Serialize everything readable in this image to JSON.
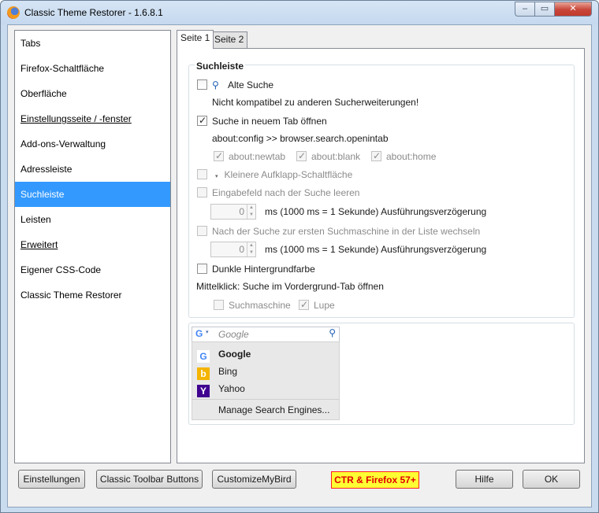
{
  "window": {
    "title": "Classic Theme Restorer - 1.6.8.1",
    "controls": {
      "minimize": "–",
      "maximize": "▭",
      "close": "✕"
    }
  },
  "sidebar": {
    "items": [
      {
        "label": "Tabs"
      },
      {
        "label": "Firefox-Schaltfläche"
      },
      {
        "label": "Oberfläche"
      },
      {
        "label": "Einstellungsseite / -fenster"
      },
      {
        "label": "Add-ons-Verwaltung"
      },
      {
        "label": "Adressleiste"
      },
      {
        "label": "Suchleiste"
      },
      {
        "label": "Leisten"
      },
      {
        "label": "Erweitert"
      },
      {
        "label": "Eigener CSS-Code"
      },
      {
        "label": "Classic Theme Restorer"
      }
    ],
    "selected": "Suchleiste"
  },
  "tabs": [
    "Seite 1",
    "Seite 2"
  ],
  "group": {
    "title": "Suchleiste",
    "alte_suche": "Alte Suche",
    "incompat": "Nicht kompatibel zu anderen Sucherweiterungen!",
    "new_tab": "Suche in neuem Tab öffnen",
    "about_config": "about:config >> browser.search.openintab",
    "sub": {
      "newtab": "about:newtab",
      "blank": "about:blank",
      "home": "about:home"
    },
    "smaller_dropdown": "Kleinere Aufklapp-Schaltfläche",
    "clear_field": "Eingabefeld nach der Suche leeren",
    "delay_1_value": "0",
    "delay_label": "ms (1000 ms = 1 Sekunde) Ausführungsverzögerung",
    "switch_first": "Nach der Suche zur ersten Suchmaschine in der Liste wechseln",
    "delay_2_value": "0",
    "dark_bg": "Dunkle Hintergrundfarbe",
    "middle_click": "Mittelklick: Suche im Vordergrund-Tab öffnen",
    "suchmaschine": "Suchmaschine",
    "lupe": "Lupe"
  },
  "preview": {
    "placeholder": "Google",
    "engines": [
      {
        "name": "Google",
        "icon": "G",
        "color": "#4285f4"
      },
      {
        "name": "Bing",
        "icon": "b",
        "color": "#f4b400"
      },
      {
        "name": "Yahoo",
        "icon": "Y",
        "color": "#400090"
      }
    ],
    "manage": "Manage Search Engines..."
  },
  "buttons": {
    "einstellungen": "Einstellungen",
    "classic_toolbar": "Classic Toolbar Buttons",
    "customize": "CustomizeMyBird",
    "ctr_firefox": "CTR & Firefox 57+",
    "hilfe": "Hilfe",
    "ok": "OK"
  }
}
